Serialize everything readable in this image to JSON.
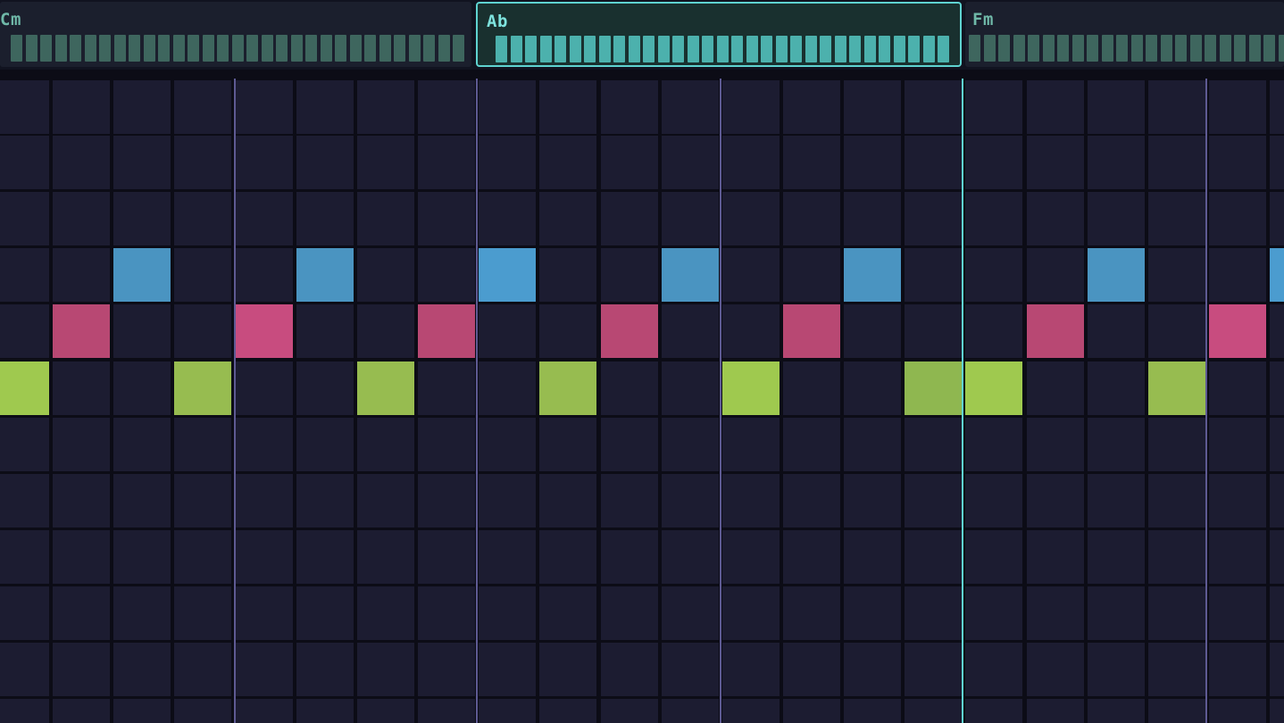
{
  "chord_bar": {
    "chords": [
      {
        "label": "Cm",
        "active": false
      },
      {
        "label": "Ab",
        "active": true
      },
      {
        "label": "Fm",
        "active": false
      }
    ]
  },
  "sequencer": {
    "columns": 21,
    "rows": 11,
    "notes": [
      {
        "col": 0,
        "row": 5,
        "color": "#9fc94f"
      },
      {
        "col": 1,
        "row": 4,
        "color": "#b84873"
      },
      {
        "col": 2,
        "row": 3,
        "color": "#4a94c1"
      },
      {
        "col": 3,
        "row": 5,
        "color": "#97bc50"
      },
      {
        "col": 4,
        "row": 4,
        "color": "#c84c7f"
      },
      {
        "col": 5,
        "row": 3,
        "color": "#4a94c1"
      },
      {
        "col": 6,
        "row": 5,
        "color": "#97bc50"
      },
      {
        "col": 7,
        "row": 4,
        "color": "#b84873"
      },
      {
        "col": 8,
        "row": 3,
        "color": "#4b9ccf"
      },
      {
        "col": 9,
        "row": 5,
        "color": "#97bc50"
      },
      {
        "col": 10,
        "row": 4,
        "color": "#b84873"
      },
      {
        "col": 11,
        "row": 3,
        "color": "#4a94c1"
      },
      {
        "col": 12,
        "row": 5,
        "color": "#9fc94f"
      },
      {
        "col": 13,
        "row": 4,
        "color": "#b84873"
      },
      {
        "col": 14,
        "row": 3,
        "color": "#4a94c1"
      },
      {
        "col": 15,
        "row": 5,
        "color": "#8fb750"
      },
      {
        "col": 16,
        "row": 5,
        "color": "#9fc94f"
      },
      {
        "col": 17,
        "row": 4,
        "color": "#b84873"
      },
      {
        "col": 18,
        "row": 3,
        "color": "#4a94c1"
      },
      {
        "col": 19,
        "row": 5,
        "color": "#97bc50"
      },
      {
        "col": 20,
        "row": 4,
        "color": "#c84c7f"
      },
      {
        "col": 21,
        "row": 3,
        "color": "#4b9ccf"
      }
    ]
  }
}
